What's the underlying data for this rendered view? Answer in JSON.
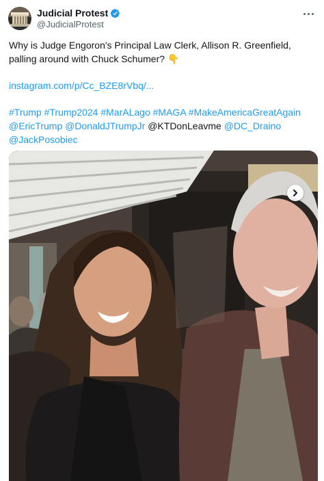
{
  "post": {
    "display_name": "Judicial Protest",
    "handle": "@JudicialProtest",
    "verified": true,
    "text": "Why is Judge Engoron's Principal Law Clerk, Allison R. Greenfield, palling around with Chuck Schumer?",
    "emoji": "👇",
    "link": "instagram.com/p/Cc_BZE8rVbq/...",
    "hashtags": [
      "#Trump",
      "#Trump2024",
      "#MarALago",
      "#MAGA",
      "#MakeAmericaGreatAgain"
    ],
    "mentions_line2": [
      "@EricTrump",
      "@DonaldJTrumpJr"
    ],
    "plain_mention": "@KTDonLeavme",
    "mentions_line2_end": [
      "@DC_Draino"
    ],
    "mentions_line3": [
      "@JackPosobiec"
    ]
  },
  "icons": {
    "verified": "verified-badge-icon",
    "more": "more-options-icon",
    "next": "chevron-right-icon"
  },
  "colors": {
    "link": "#1d9bf0",
    "text": "#0f1419",
    "secondary": "#536471"
  }
}
